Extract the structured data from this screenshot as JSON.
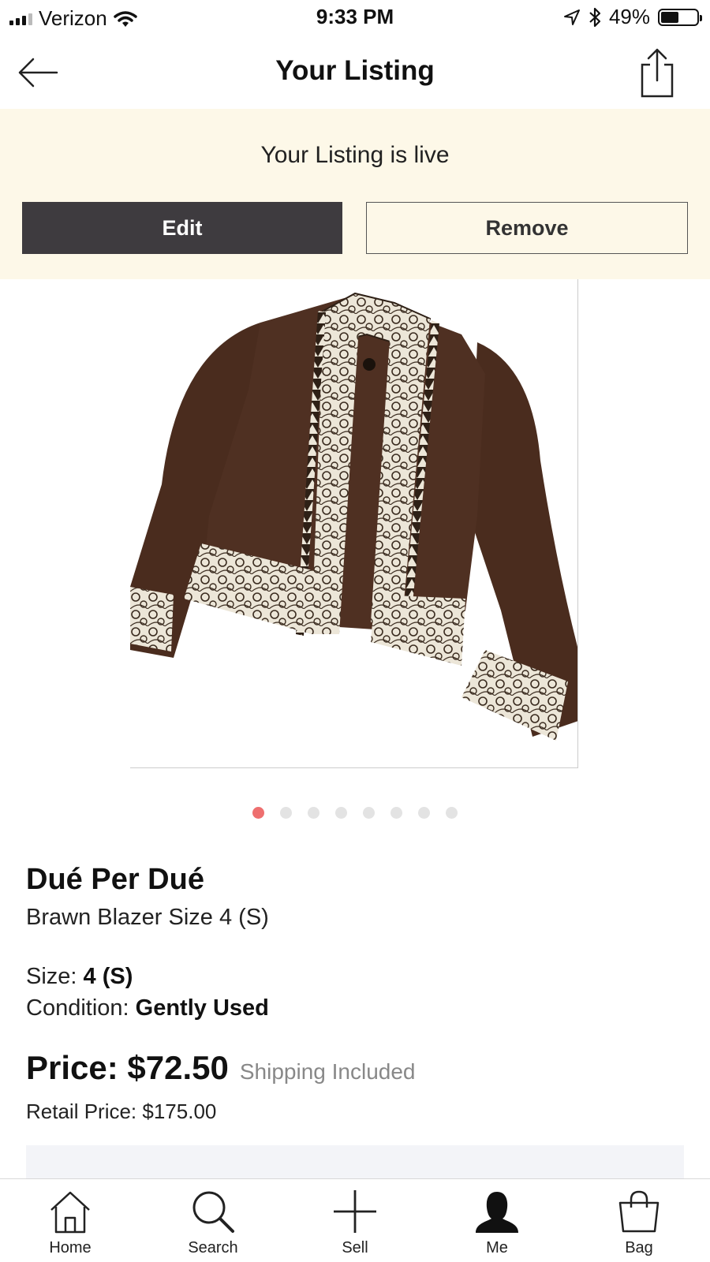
{
  "status_bar": {
    "carrier": "Verizon",
    "time": "9:33 PM",
    "battery": "49%",
    "battery_level": 0.49
  },
  "header": {
    "title": "Your Listing",
    "back_icon": "arrow-left-icon",
    "share_icon": "share-icon"
  },
  "banner": {
    "message": "Your Listing is live",
    "edit_label": "Edit",
    "remove_label": "Remove",
    "background": "#fdf8e8",
    "edit_color": "#3e3b3f"
  },
  "gallery": {
    "image_count": 8,
    "active_index": 0,
    "active_dot_color": "#ee6f6f"
  },
  "product": {
    "brand": "Dué Per Dué",
    "title": "Brawn Blazer Size 4 (S)",
    "size_label": "Size:",
    "size_value": "4 (S)",
    "condition_label": "Condition:",
    "condition_value": "Gently Used",
    "price": "Price: $72.50",
    "shipping": "Shipping Included",
    "retail_price": "Retail Price: $175.00"
  },
  "tabbar": {
    "items": [
      {
        "label": "Home",
        "icon": "home-icon"
      },
      {
        "label": "Search",
        "icon": "search-icon"
      },
      {
        "label": "Sell",
        "icon": "plus-icon"
      },
      {
        "label": "Me",
        "icon": "person-icon"
      },
      {
        "label": "Bag",
        "icon": "bag-icon"
      }
    ],
    "active_index": 3
  }
}
